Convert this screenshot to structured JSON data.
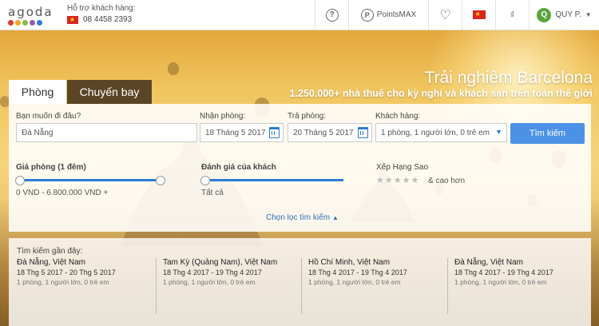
{
  "header": {
    "logo_text": "agoda",
    "logo_colors": [
      "#e33b2e",
      "#f5a623",
      "#7ec142",
      "#9b59b6",
      "#2d7cd6"
    ],
    "support_label": "Hỗ trợ khách hàng:",
    "support_phone": "08 4458 2393",
    "help_icon": "?",
    "pointsmax_label": "PointsMAX",
    "pointsmax_icon": "P",
    "user_initial": "Q",
    "user_name": "QUY P."
  },
  "hero": {
    "title": "Trải nghiệm Barcelona",
    "subtitle": "1.250.000+ nhà thuê cho kỳ nghỉ và khách sạn trên toàn thế giới"
  },
  "tabs": [
    {
      "label": "Phòng",
      "active": true
    },
    {
      "label": "Chuyến bay",
      "active": false
    }
  ],
  "search": {
    "destination_label": "Bạn muốn đi đâu?",
    "destination_value": "Đà Nẵng",
    "checkin_label": "Nhận phòng:",
    "checkin_value": "18 Tháng 5 2017",
    "checkout_label": "Trả phòng:",
    "checkout_value": "20 Tháng 5 2017",
    "guests_label": "Khách hàng:",
    "guests_value": "1 phòng, 1 người lớn, 0 trẻ em",
    "search_button": "Tìm kiếm"
  },
  "filters": {
    "price_label": "Giá phòng (1 đêm)",
    "price_value": "0 VND - 6.800.000 VND +",
    "price_range_fraction": [
      0,
      1
    ],
    "rating_label": "Đánh giá của khách",
    "rating_value": "Tất cả",
    "rating_fraction": 0,
    "stars_label": "Xếp Hạng Sao",
    "stars_suffix": "& cao hơn",
    "star_glyphs": [
      "★",
      "★",
      "★",
      "★",
      "★"
    ],
    "more_filters": "Chọn lọc tìm kiếm",
    "more_filters_arrow": "▲"
  },
  "recent": {
    "title": "Tìm kiếm gần đây:",
    "items": [
      {
        "city": "Đà Nẵng, Việt Nam",
        "dates": "18 Thg 5 2017 - 20 Thg 5 2017",
        "guests": "1 phòng, 1 người lớn, 0 trẻ em"
      },
      {
        "city": "Tam Kỳ (Quảng Nam), Việt Nam",
        "dates": "18 Thg 4 2017 - 19 Thg 4 2017",
        "guests": "1 phòng, 1 người lớn, 0 trẻ em"
      },
      {
        "city": "Hồ Chí Minh, Việt Nam",
        "dates": "18 Thg 4 2017 - 19 Thg 4 2017",
        "guests": "1 phòng, 1 người lớn, 0 trẻ em"
      },
      {
        "city": "Đà Nẵng, Việt Nam",
        "dates": "18 Thg 4 2017 - 19 Thg 4 2017",
        "guests": "1 phòng, 1 người lớn, 0 trẻ em"
      }
    ]
  }
}
